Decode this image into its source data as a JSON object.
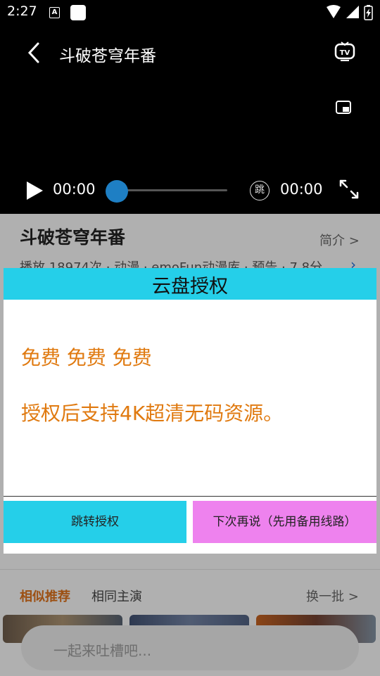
{
  "status_bar": {
    "time": "2:27",
    "notification_icon_letter": "A"
  },
  "video": {
    "title": "斗破苍穹年番",
    "current_time": "00:00",
    "total_time": "00:00",
    "skip_label": "跳",
    "progress": 0
  },
  "detail": {
    "title": "斗破苍穹年番",
    "intro_label": "简介 >",
    "meta": "播放 18974次 · 动漫 · emoFun动漫库 · 预告 · 7.8分",
    "tabs": {
      "similar": "相似推荐",
      "cast": "相同主演",
      "refresh": "换一批 >"
    },
    "comment_placeholder": "一起来吐槽吧..."
  },
  "dialog": {
    "title": "云盘授权",
    "line1": "免费 免费 免费",
    "line2": "授权后支持4K超清无码资源。",
    "confirm_label": "跳转授权",
    "cancel_label": "下次再说（先用备用线路）"
  },
  "colors": {
    "dialog_accent": "#25cfe9",
    "dialog_text": "#e07a10",
    "secondary_button": "#ee82ee",
    "seek_thumb": "#1e7fc4",
    "active_tab": "#d96f1b"
  }
}
